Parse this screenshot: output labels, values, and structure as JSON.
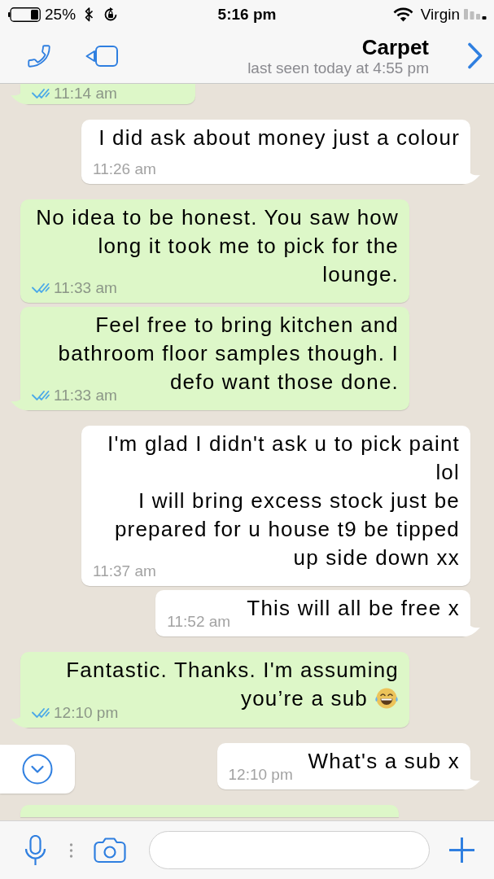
{
  "status_bar": {
    "battery_percentage": "25%",
    "time": "5:16 pm",
    "carrier": "Virgin"
  },
  "header": {
    "contact_name": "Carpet",
    "last_seen": "last seen today at 4:55 pm"
  },
  "messages": [
    {
      "kind": "sent",
      "cut_off": true,
      "time": "11:14 am",
      "read": true
    },
    {
      "kind": "received",
      "text": "I did ask about money just a colour",
      "time": "11:26 am"
    },
    {
      "kind": "sent",
      "text": "No idea to be honest. You saw how long it took me to pick for the lounge.",
      "time": "11:33 am",
      "read": true
    },
    {
      "kind": "sent",
      "text": "Feel free to bring kitchen and bathroom floor samples though. I defo want those done.",
      "time": "11:33 am",
      "read": true
    },
    {
      "kind": "received",
      "text": "I'm glad I didn't ask u to pick paint lol\nI will bring excess stock just be prepared for u house t9 be tipped up side down xx",
      "time": "11:37 am"
    },
    {
      "kind": "received",
      "text": "This will all be free x",
      "time": "11:52 am"
    },
    {
      "kind": "sent",
      "text": "Fantastic. Thanks. I'm assuming you’re a sub",
      "emoji": true,
      "time": "12:10 pm",
      "read": true
    },
    {
      "kind": "received",
      "text": "What's a sub x",
      "time": "12:10 pm"
    },
    {
      "kind": "sent",
      "cut_off": true
    }
  ]
}
